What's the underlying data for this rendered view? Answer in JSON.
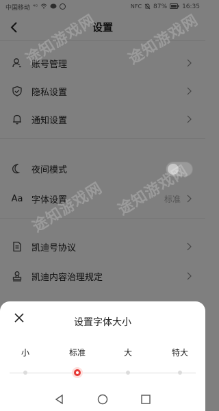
{
  "status_bar": {
    "carrier": "中国移动",
    "signal": "⁴ᴳ",
    "battery": "87%",
    "time": "16:35",
    "nfc": "NFC"
  },
  "header": {
    "title": "设置",
    "back_icon": "chevron-left-icon"
  },
  "settings": {
    "account": {
      "label": "账号管理",
      "icon": "user-icon"
    },
    "privacy": {
      "label": "隐私设置",
      "icon": "shield-icon"
    },
    "notify": {
      "label": "通知设置",
      "icon": "bell-icon"
    },
    "night": {
      "label": "夜间模式",
      "icon": "moon-icon",
      "enabled": false
    },
    "font": {
      "label": "字体设置",
      "icon": "font-aa-icon",
      "icon_text": "Aa",
      "value": "标准"
    },
    "agreement": {
      "label": "凯迪号协议",
      "icon": "document-icon"
    },
    "governance": {
      "label": "凯迪内容治理规定",
      "icon": "stamp-icon"
    }
  },
  "watermark": {
    "text": "途知游戏网"
  },
  "font_sheet": {
    "title": "设置字体大小",
    "close_icon": "close-icon",
    "options": [
      "小",
      "标准",
      "大",
      "特大"
    ],
    "selected_index": 1,
    "accent": "#e53935"
  },
  "navbar": {
    "back": "triangle-back-icon",
    "home": "circle-home-icon",
    "recents": "square-recents-icon"
  }
}
